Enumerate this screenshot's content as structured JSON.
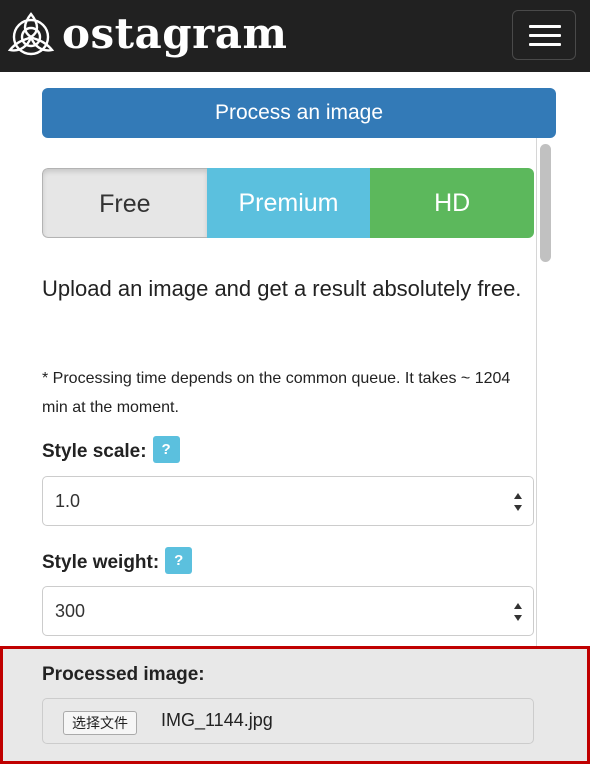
{
  "header": {
    "brand": "ostagram",
    "menu_icon": "hamburger-menu-icon",
    "logo_icon": "ostagram-logo-icon"
  },
  "panel": {
    "title": "Process an image"
  },
  "plans": {
    "free": "Free",
    "premium": "Premium",
    "hd": "HD",
    "selected": "Free"
  },
  "intro_text": "Upload an image and get a result absolutely free.",
  "note_text": "* Processing time depends on the common queue. It takes ~ 1204 min at the moment.",
  "style_scale": {
    "label": "Style scale:",
    "help": "?",
    "value": "1.0"
  },
  "style_weight": {
    "label": "Style weight:",
    "help": "?",
    "value": "300"
  },
  "processed_image": {
    "label": "Processed image:",
    "button_label": "选择文件",
    "file_name": "IMG_1144.jpg"
  },
  "colors": {
    "navbar": "#212121",
    "primary": "#337ab7",
    "info": "#5bc0de",
    "success": "#5cb85c",
    "highlight_border": "#c00000"
  }
}
